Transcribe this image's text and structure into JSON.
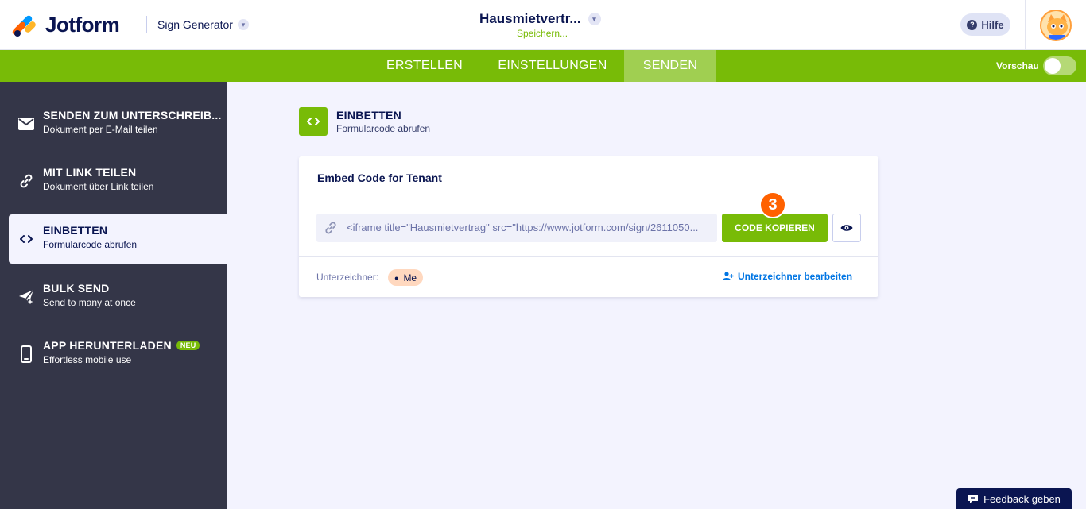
{
  "header": {
    "logo_text": "Jotform",
    "product": "Sign Generator",
    "doc_title": "Hausmietvertr...",
    "saving_status": "Speichern...",
    "help_label": "Hilfe"
  },
  "nav": {
    "tabs": [
      {
        "label": "ERSTELLEN"
      },
      {
        "label": "EINSTELLUNGEN"
      },
      {
        "label": "SENDEN",
        "active": true
      }
    ],
    "preview_label": "Vorschau",
    "preview_enabled": false
  },
  "sidebar": {
    "items": [
      {
        "title": "SENDEN ZUM UNTERSCHREIB...",
        "sub": "Dokument per E-Mail teilen",
        "icon": "mail-icon"
      },
      {
        "title": "MIT LINK TEILEN",
        "sub": "Dokument über Link teilen",
        "icon": "link-icon"
      },
      {
        "title": "EINBETTEN",
        "sub": "Formularcode abrufen",
        "icon": "code-icon",
        "active": true
      },
      {
        "title": "BULK SEND",
        "sub": "Send to many at once",
        "icon": "paper-plane-icon"
      },
      {
        "title": "APP HERUNTERLADEN",
        "sub": "Effortless mobile use",
        "icon": "phone-icon",
        "badge": "NEU"
      }
    ]
  },
  "main": {
    "section_title": "EINBETTEN",
    "section_sub": "Formularcode abrufen",
    "card": {
      "title": "Embed Code for Tenant",
      "code": "<iframe title=\"Hausmietvertrag\" src=\"https://www.jotform.com/sign/2611050...",
      "copy_label": "CODE KOPIEREN",
      "step_number": "3",
      "signer_label": "Unterzeichner:",
      "signer_chip": "Me",
      "edit_signers_label": "Unterzeichner bearbeiten"
    }
  },
  "feedback_label": "Feedback geben",
  "colors": {
    "brand_green": "#78bb07",
    "sidebar_bg": "#343648",
    "navy": "#0a1551",
    "accent_orange": "#ff6100",
    "link_blue": "#0075e3"
  }
}
